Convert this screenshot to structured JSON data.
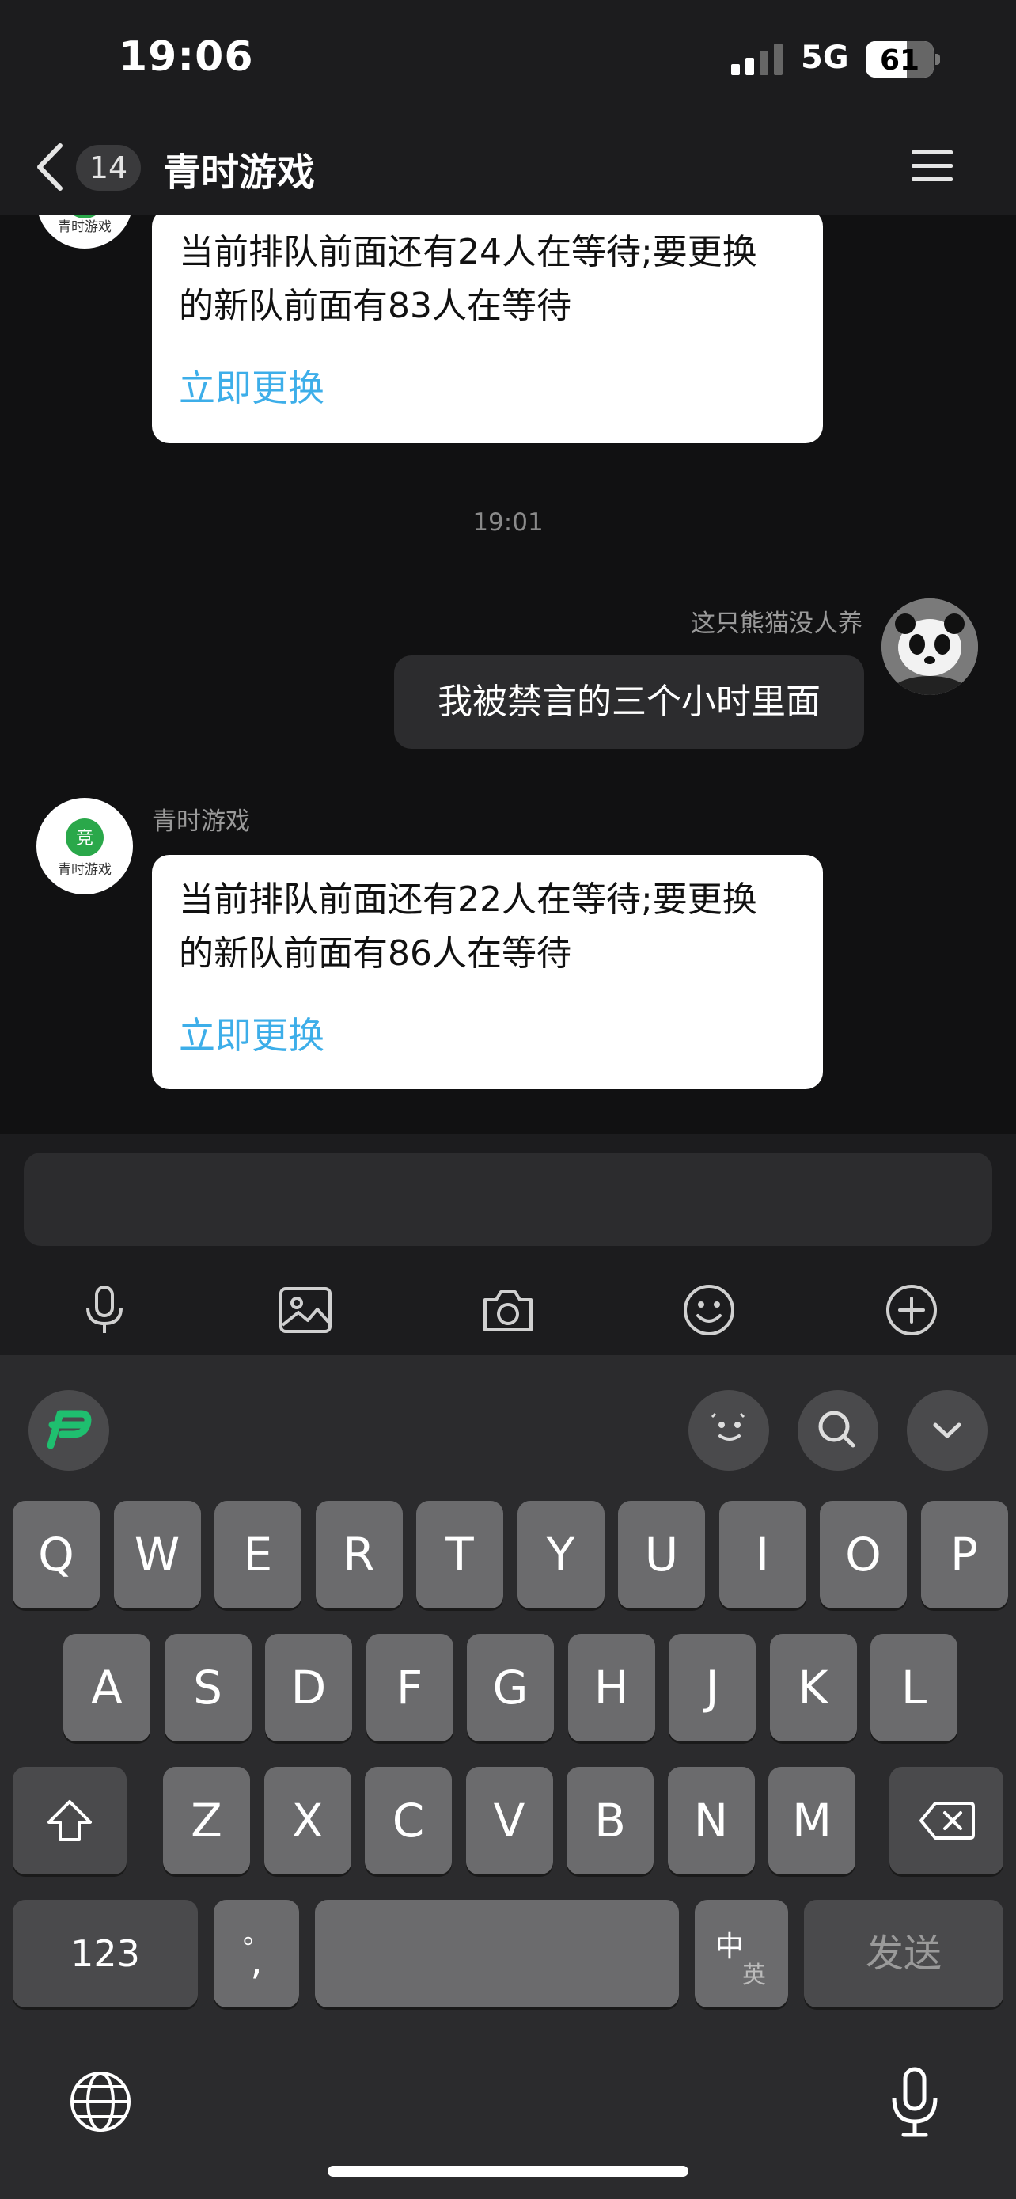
{
  "status_bar": {
    "time": "19:06",
    "network": "5G",
    "battery_level": "61",
    "battery_fraction": 0.61
  },
  "header": {
    "unread_count": "14",
    "title": "青时游戏"
  },
  "messages": {
    "bot_card_1": {
      "line1": "当前排队前面还有24人在等待;要更换",
      "line2": "的新队前面有83人在等待",
      "link": "立即更换"
    },
    "timestamp": "19:01",
    "user_message": {
      "sender": "这只熊猫没人养",
      "text": "我被禁言的三个小时里面"
    },
    "bot_card_2": {
      "sender": "青时游戏",
      "line1": "当前排队前面还有22人在等待;要更换",
      "line2": "的新队前面有86人在等待",
      "link": "立即更换"
    }
  },
  "bot_avatar_text": "青时游戏",
  "composer": {
    "tools": [
      "microphone-icon",
      "image-icon",
      "camera-icon",
      "emoji-icon",
      "plus-circle-icon"
    ]
  },
  "keyboard": {
    "row1": [
      "Q",
      "W",
      "E",
      "R",
      "T",
      "Y",
      "U",
      "I",
      "O",
      "P"
    ],
    "row2": [
      "A",
      "S",
      "D",
      "F",
      "G",
      "H",
      "J",
      "K",
      "L"
    ],
    "row3": [
      "Z",
      "X",
      "C",
      "V",
      "B",
      "N",
      "M"
    ],
    "numbers_key": "123",
    "punct_top": "。",
    "punct_bottom": ",",
    "lang_cn": "中",
    "lang_en": "英",
    "send_key": "发送"
  },
  "colors": {
    "link": "#3daee9",
    "logo_green": "#2aa84a",
    "app_icon_green": "#1fbf6f"
  }
}
